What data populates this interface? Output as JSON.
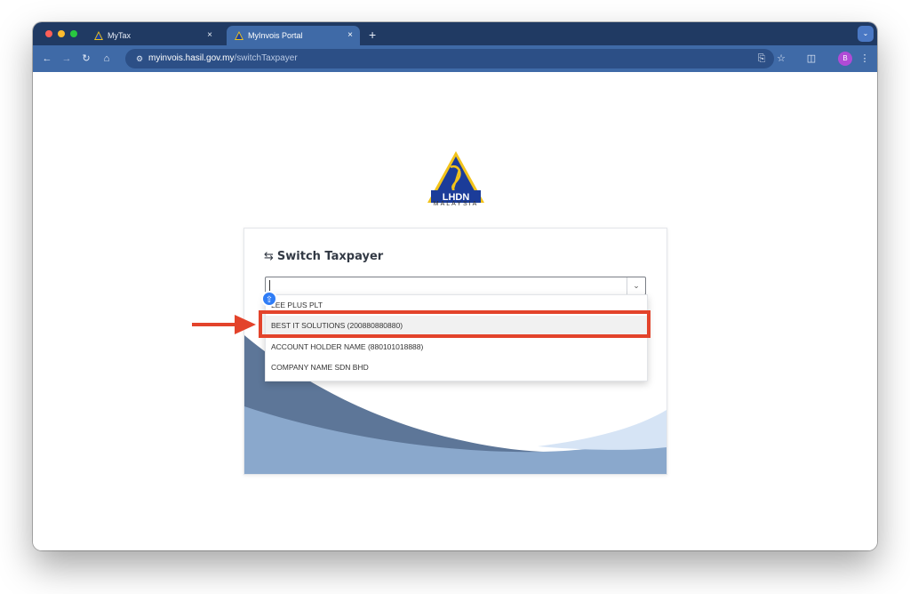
{
  "browser": {
    "tabs": [
      {
        "label": "MyTax",
        "active": false
      },
      {
        "label": "MyInvois Portal",
        "active": true
      }
    ],
    "url_host": "myinvois.hasil.gov.my",
    "url_path": "/switchTaxpayer",
    "profile_initial": "B",
    "new_tab_symbol": "+",
    "close_symbol": "×"
  },
  "logo": {
    "text": "LHDN",
    "subtext": "MALAYSIA"
  },
  "switch_panel": {
    "title": "Switch Taxpayer",
    "select_value": "",
    "options": [
      "LEE PLUS PLT",
      "BEST IT SOLUTIONS (200880880880)",
      "ACCOUNT HOLDER NAME (880101018888)",
      "COMPANY NAME SDN BHD"
    ],
    "highlighted_option": "BEST IT SOLUTIONS (200880880880)"
  },
  "colors": {
    "tabstrip": "#203a63",
    "toolbar": "#3f6aa7",
    "annotation_red": "#e3432b",
    "wave_dark": "#5d7698",
    "wave_mid": "#8aa8cc",
    "wave_light": "#d6e4f5"
  }
}
